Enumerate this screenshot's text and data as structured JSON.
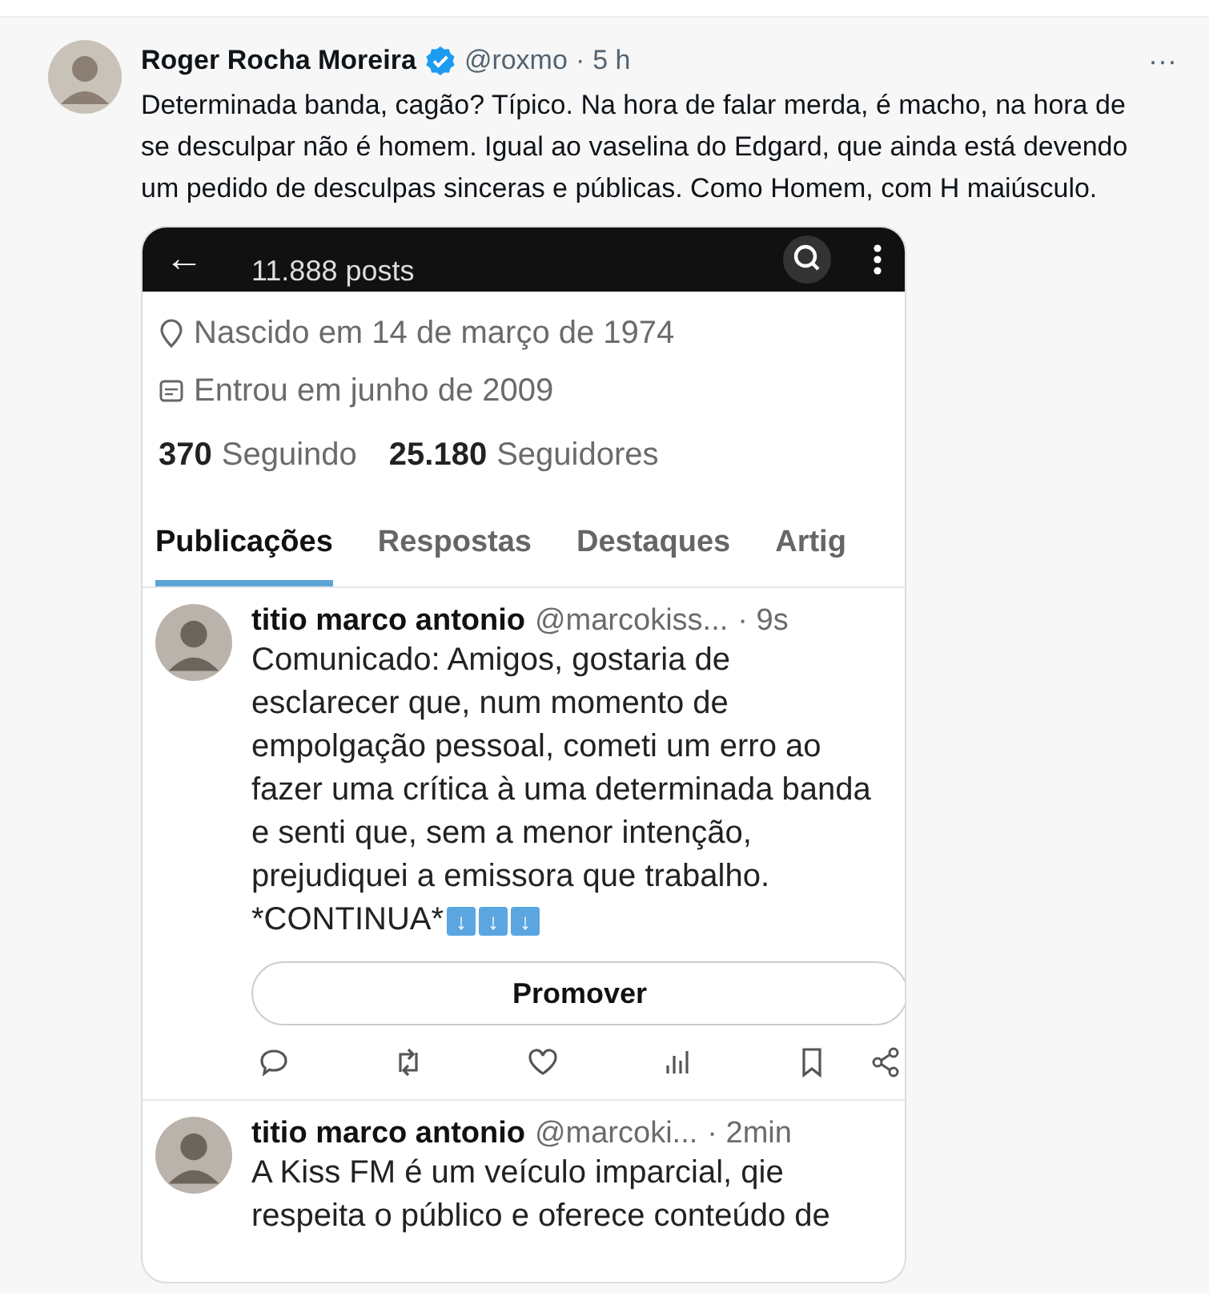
{
  "tweet": {
    "author": "Roger Rocha Moreira",
    "verified": true,
    "handle": "@roxmo",
    "separator": "·",
    "time": "5 h",
    "more": "···",
    "text": "Determinada banda, cagão? Típico. Na hora de falar merda, é macho, na hora de se desculpar não é homem. Igual ao vaselina do Edgard, que ainda está devendo um pedido de desculpas sinceras e públicas. Como Homem, com H maiúsculo."
  },
  "embedded_screenshot": {
    "header": {
      "back": "←",
      "posts": "11.888 posts"
    },
    "profile": {
      "birth": "Nascido em 14 de março de 1974",
      "joined": "Entrou em junho de 2009",
      "following_count": "370",
      "following_label": "Seguindo",
      "followers_count": "25.180",
      "followers_label": "Seguidores"
    },
    "tabs": [
      {
        "label": "Publicações",
        "selected": true
      },
      {
        "label": "Respostas",
        "selected": false
      },
      {
        "label": "Destaques",
        "selected": false
      },
      {
        "label": "Artig",
        "selected": false
      }
    ],
    "posts": [
      {
        "name": "titio marco antonio",
        "handle": "@marcokiss...",
        "time": "· 9s",
        "text": "Comunicado: Amigos, gostaria de esclarecer que, num momento de empolgação pessoal, cometi um erro ao fazer uma crítica à uma determinada banda e senti que, sem a menor intenção, prejudiquei a  emissora que trabalho.",
        "continuation": "*CONTINUA*",
        "arrows": [
          "↓",
          "↓",
          "↓"
        ],
        "promote_button": "Promover",
        "show_actions": true
      },
      {
        "name": "titio marco antonio",
        "handle": "@marcoki...",
        "time": "· 2min",
        "text": "A Kiss FM é um veículo imparcial, qie respeita o público e oferece conteúdo de",
        "show_actions": false
      }
    ]
  }
}
